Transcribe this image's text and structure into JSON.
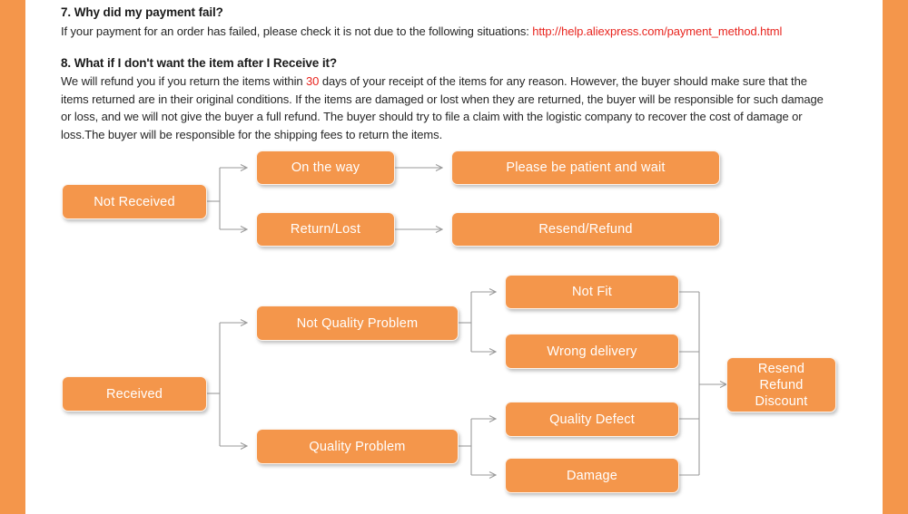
{
  "page": {
    "background_color": "#ffffff",
    "accent_color": "#F4964B",
    "link_color": "#e8251f",
    "node_text_color": "#ffffff",
    "connector_color": "#9a9a9a"
  },
  "faq": [
    {
      "number": "7.",
      "question": "7. Why did my payment fail?",
      "answer_prefix": "If your payment for an order has failed, please check it is not due to the following  situations: ",
      "link_text": "http://help.aliexpress.com/payment_method.html"
    },
    {
      "number": "8.",
      "question": "8. What if I don't want the item after I Receive it?",
      "answer_part1": "We will refund you if you return the items within ",
      "answer_highlight": "30",
      "answer_part2": " days of your receipt of the items for any reason. However, the buyer should make sure that the items returned are in their original conditions.  If the items are damaged or lost when they are returned, the buyer will be responsible for such damage or loss, and we will not give the buyer a full refund.  The buyer should try to file a claim with the logistic company to recover the cost of damage or loss.The buyer will be responsible for the shipping fees to return the items."
    }
  ],
  "flowcharts": [
    {
      "id": "not-received",
      "root": "Not Received",
      "branches": [
        {
          "stage1": "On the way",
          "stage2": "Please be patient and wait"
        },
        {
          "stage1": "Return/Lost",
          "stage2": "Resend/Refund"
        }
      ]
    },
    {
      "id": "received",
      "root": "Received",
      "branches": [
        {
          "stage1": "Not Quality Problem",
          "stage2": [
            "Not Fit",
            "Wrong delivery"
          ]
        },
        {
          "stage1": "Quality Problem",
          "stage2": [
            "Quality Defect",
            "Damage"
          ]
        }
      ],
      "outcome": "Resend\nRefund\nDiscount",
      "outcome_lines": [
        "Resend",
        "Refund",
        "Discount"
      ]
    }
  ],
  "nodes": {
    "not_received": "Not Received",
    "on_the_way": "On the way",
    "please_be_patient": "Please be patient and wait",
    "return_lost": "Return/Lost",
    "resend_refund": "Resend/Refund",
    "received": "Received",
    "not_quality_problem": "Not Quality Problem",
    "quality_problem": "Quality Problem",
    "not_fit": "Not Fit",
    "wrong_delivery": "Wrong delivery",
    "quality_defect": "Quality Defect",
    "damage": "Damage",
    "outcome_line1": "Resend",
    "outcome_line2": "Refund",
    "outcome_line3": "Discount"
  }
}
